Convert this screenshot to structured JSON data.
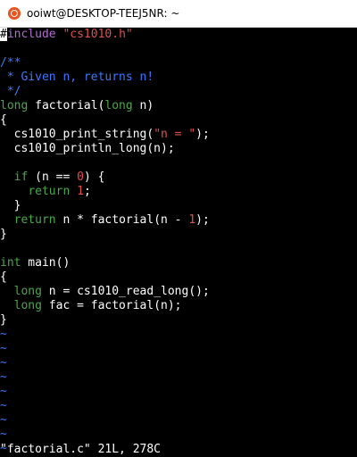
{
  "window": {
    "title": "ooiwt@DESKTOP-TEEJ5NR: ~",
    "icon": "ubuntu-icon"
  },
  "colors": {
    "preproc": "#b36bd6",
    "string": "#e05050",
    "comment": "#3b78ff",
    "type": "#4aa84a",
    "keyword": "#4aa84a",
    "number": "#e05050",
    "text": "#ffffff",
    "tilde": "#3b78ff"
  },
  "editor": {
    "lines": [
      [
        {
          "t": "#",
          "c": "cursor"
        },
        {
          "t": "include ",
          "c": "preproc"
        },
        {
          "t": "\"cs1010.h\"",
          "c": "string"
        }
      ],
      [],
      [
        {
          "t": "/**",
          "c": "comment"
        }
      ],
      [
        {
          "t": " * Given n, returns n!",
          "c": "comment"
        }
      ],
      [
        {
          "t": " */",
          "c": "comment"
        }
      ],
      [
        {
          "t": "long",
          "c": "type"
        },
        {
          "t": " factorial(",
          "c": "text"
        },
        {
          "t": "long",
          "c": "type"
        },
        {
          "t": " n)",
          "c": "text"
        }
      ],
      [
        {
          "t": "{",
          "c": "text"
        }
      ],
      [
        {
          "t": "  cs1010_print_string(",
          "c": "text"
        },
        {
          "t": "\"n = \"",
          "c": "string"
        },
        {
          "t": ");",
          "c": "text"
        }
      ],
      [
        {
          "t": "  cs1010_println_long(n);",
          "c": "text"
        }
      ],
      [],
      [
        {
          "t": "  ",
          "c": "text"
        },
        {
          "t": "if",
          "c": "keyword"
        },
        {
          "t": " (n == ",
          "c": "text"
        },
        {
          "t": "0",
          "c": "number"
        },
        {
          "t": ") {",
          "c": "text"
        }
      ],
      [
        {
          "t": "    ",
          "c": "text"
        },
        {
          "t": "return",
          "c": "keyword"
        },
        {
          "t": " ",
          "c": "text"
        },
        {
          "t": "1",
          "c": "number"
        },
        {
          "t": ";",
          "c": "text"
        }
      ],
      [
        {
          "t": "  }",
          "c": "text"
        }
      ],
      [
        {
          "t": "  ",
          "c": "text"
        },
        {
          "t": "return",
          "c": "keyword"
        },
        {
          "t": " n * factorial(n - ",
          "c": "text"
        },
        {
          "t": "1",
          "c": "number"
        },
        {
          "t": ");",
          "c": "text"
        }
      ],
      [
        {
          "t": "}",
          "c": "text"
        }
      ],
      [],
      [
        {
          "t": "int",
          "c": "type"
        },
        {
          "t": " main()",
          "c": "text"
        }
      ],
      [
        {
          "t": "{",
          "c": "text"
        }
      ],
      [
        {
          "t": "  ",
          "c": "text"
        },
        {
          "t": "long",
          "c": "type"
        },
        {
          "t": " n = cs1010_read_long();",
          "c": "text"
        }
      ],
      [
        {
          "t": "  ",
          "c": "text"
        },
        {
          "t": "long",
          "c": "type"
        },
        {
          "t": " fac = factorial(n);",
          "c": "text"
        }
      ],
      [
        {
          "t": "}",
          "c": "text"
        }
      ]
    ],
    "tilde_lines": [
      "~",
      "~",
      "~",
      "~",
      "~",
      "~",
      "~",
      "~",
      "~"
    ]
  },
  "status_line": "\"factorial.c\" 21L, 278C"
}
